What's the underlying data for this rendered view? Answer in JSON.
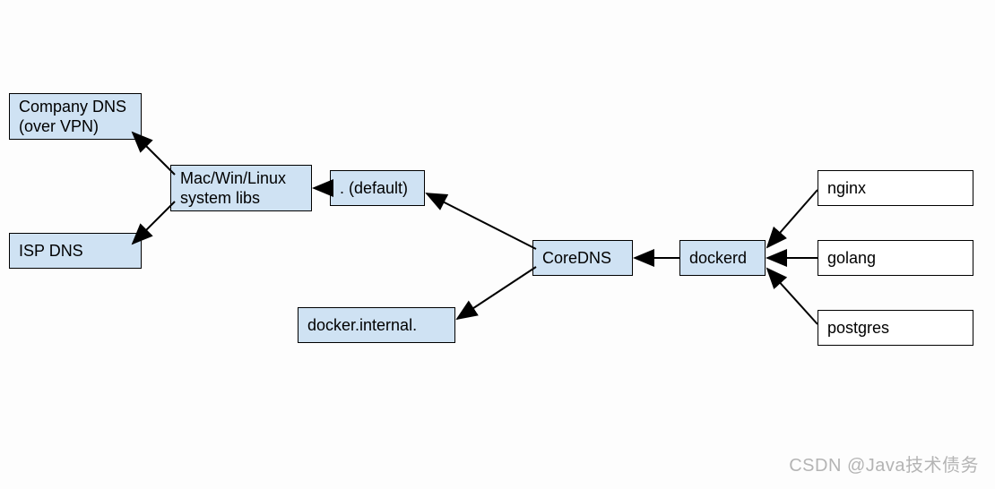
{
  "nodes": {
    "company_dns": {
      "line1": "Company DNS",
      "line2": "(over VPN)"
    },
    "isp_dns": "ISP DNS",
    "syslibs": {
      "line1": "Mac/Win/Linux",
      "line2": "system libs"
    },
    "default_zone": ". (default)",
    "docker_internal": "docker.internal.",
    "coredns": "CoreDNS",
    "dockerd": "dockerd",
    "nginx": "nginx",
    "golang": "golang",
    "postgres": "postgres"
  },
  "watermark": "CSDN @Java技术债务"
}
